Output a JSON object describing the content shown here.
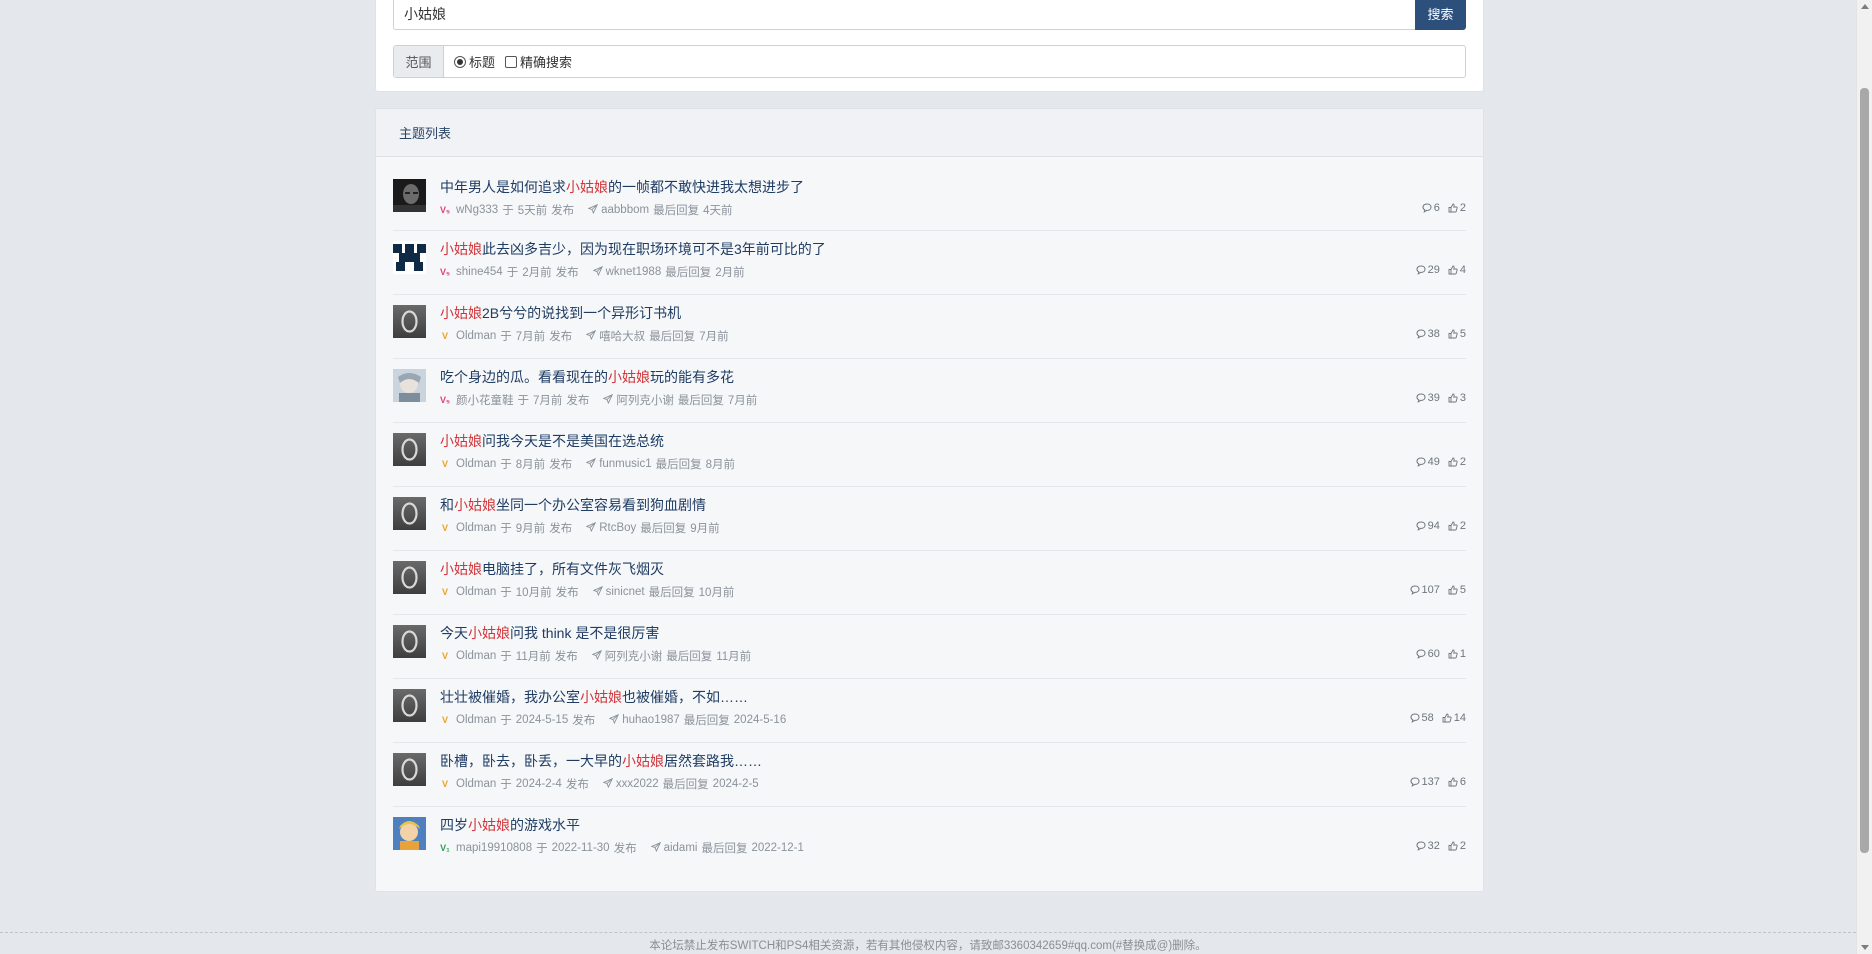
{
  "search": {
    "query": "小姑娘",
    "button_label": "搜索",
    "range_label": "范围",
    "option_title": "标题",
    "option_exact": "精确搜索"
  },
  "list": {
    "header": "主题列表",
    "published_word": "发布",
    "replied_word": "最后回复",
    "at_word": "于",
    "threads": [
      {
        "title_pre": "中年男人是如何追求",
        "title_hl": "小姑娘",
        "title_post": "的一帧都不敢快进我太想进步了",
        "author": "wNg333",
        "posted": "5天前",
        "last_replier": "aabbbom",
        "last_time": "4天前",
        "replies": "6",
        "likes": "2",
        "badge": "pink",
        "avatar": "dark-face"
      },
      {
        "title_pre": "",
        "title_hl": "小姑娘",
        "title_post": "此去凶多吉少，因为现在职场环境可不是3年前可比的了",
        "author": "shine454",
        "posted": "2月前",
        "last_replier": "wknet1988",
        "last_time": "2月前",
        "replies": "29",
        "likes": "4",
        "badge": "pink",
        "avatar": "pixel"
      },
      {
        "title_pre": "",
        "title_hl": "小姑娘",
        "title_post": "2B兮兮的说找到一个异形订书机",
        "author": "Oldman",
        "posted": "7月前",
        "last_replier": "嘻哈大叔",
        "last_time": "7月前",
        "replies": "38",
        "likes": "5",
        "badge": "orange",
        "avatar": "letter-o"
      },
      {
        "title_pre": "吃个身边的瓜。看看现在的",
        "title_hl": "小姑娘",
        "title_post": "玩的能有多花",
        "author": "颜小花童鞋",
        "posted": "7月前",
        "last_replier": "阿列克小谢",
        "last_time": "7月前",
        "replies": "39",
        "likes": "3",
        "badge": "pink",
        "avatar": "anime"
      },
      {
        "title_pre": "",
        "title_hl": "小姑娘",
        "title_post": "问我今天是不是美国在选总统",
        "author": "Oldman",
        "posted": "8月前",
        "last_replier": "funmusic1",
        "last_time": "8月前",
        "replies": "49",
        "likes": "2",
        "badge": "orange",
        "avatar": "letter-o"
      },
      {
        "title_pre": "和",
        "title_hl": "小姑娘",
        "title_post": "坐同一个办公室容易看到狗血剧情",
        "author": "Oldman",
        "posted": "9月前",
        "last_replier": "RtcBoy",
        "last_time": "9月前",
        "replies": "94",
        "likes": "2",
        "badge": "orange",
        "avatar": "letter-o"
      },
      {
        "title_pre": "",
        "title_hl": "小姑娘",
        "title_post": "电脑挂了，所有文件灰飞烟灭",
        "author": "Oldman",
        "posted": "10月前",
        "last_replier": "sinicnet",
        "last_time": "10月前",
        "replies": "107",
        "likes": "5",
        "badge": "orange",
        "avatar": "letter-o"
      },
      {
        "title_pre": "今天",
        "title_hl": "小姑娘",
        "title_post": "问我 think 是不是很厉害",
        "author": "Oldman",
        "posted": "11月前",
        "last_replier": "阿列克小谢",
        "last_time": "11月前",
        "replies": "60",
        "likes": "1",
        "badge": "orange",
        "avatar": "letter-o"
      },
      {
        "title_pre": "壮壮被催婚，我办公室",
        "title_hl": "小姑娘",
        "title_post": "也被催婚，不如……",
        "author": "Oldman",
        "posted": "2024-5-15",
        "last_replier": "huhao1987",
        "last_time": "2024-5-16",
        "replies": "58",
        "likes": "14",
        "badge": "orange",
        "avatar": "letter-o"
      },
      {
        "title_pre": "卧槽，卧去，卧丢，一大早的",
        "title_hl": "小姑娘",
        "title_post": "居然套路我……",
        "author": "Oldman",
        "posted": "2024-2-4",
        "last_replier": "xxx2022",
        "last_time": "2024-2-5",
        "replies": "137",
        "likes": "6",
        "badge": "orange",
        "avatar": "letter-o"
      },
      {
        "title_pre": "四岁",
        "title_hl": "小姑娘",
        "title_post": "的游戏水平",
        "author": "mapi19910808",
        "posted": "2022-11-30",
        "last_replier": "aidami",
        "last_time": "2022-12-1",
        "replies": "32",
        "likes": "2",
        "badge": "green",
        "avatar": "cartoon"
      }
    ]
  },
  "footer": {
    "notice": "本论坛禁止发布SWITCH和PS4相关资源，若有其他侵权内容，请致邮3360342659#qq.com(#替换成@)删除。"
  },
  "colors": {
    "accent": "#2c4f7b",
    "highlight": "#d0363b",
    "badge_pink": "#e0417a",
    "badge_orange": "#f0a020",
    "badge_green": "#2aa05a"
  }
}
